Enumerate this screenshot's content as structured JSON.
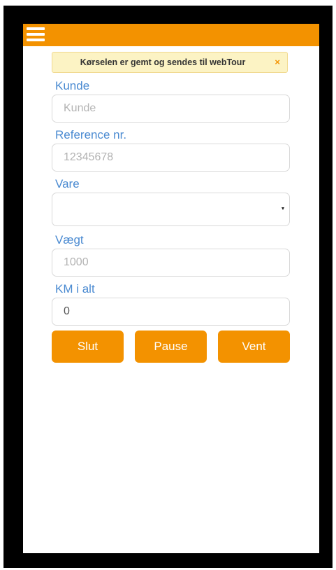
{
  "colors": {
    "accent": "#f39200",
    "label": "#4a8ad1",
    "alert_bg": "#fcf3c4"
  },
  "topbar": {
    "menu_icon": "hamburger-icon"
  },
  "alert": {
    "message": "Kørselen er gemt og sendes til webTour",
    "close": "×"
  },
  "form": {
    "customer": {
      "label": "Kunde",
      "placeholder": "Kunde",
      "value": ""
    },
    "reference": {
      "label": "Reference nr.",
      "placeholder": "12345678",
      "value": ""
    },
    "goods": {
      "label": "Vare",
      "selected": ""
    },
    "weight": {
      "label": "Vægt",
      "placeholder": "1000",
      "value": ""
    },
    "km_total": {
      "label": "KM i alt",
      "value": "0"
    }
  },
  "buttons": {
    "stop": "Slut",
    "pause": "Pause",
    "wait": "Vent"
  }
}
